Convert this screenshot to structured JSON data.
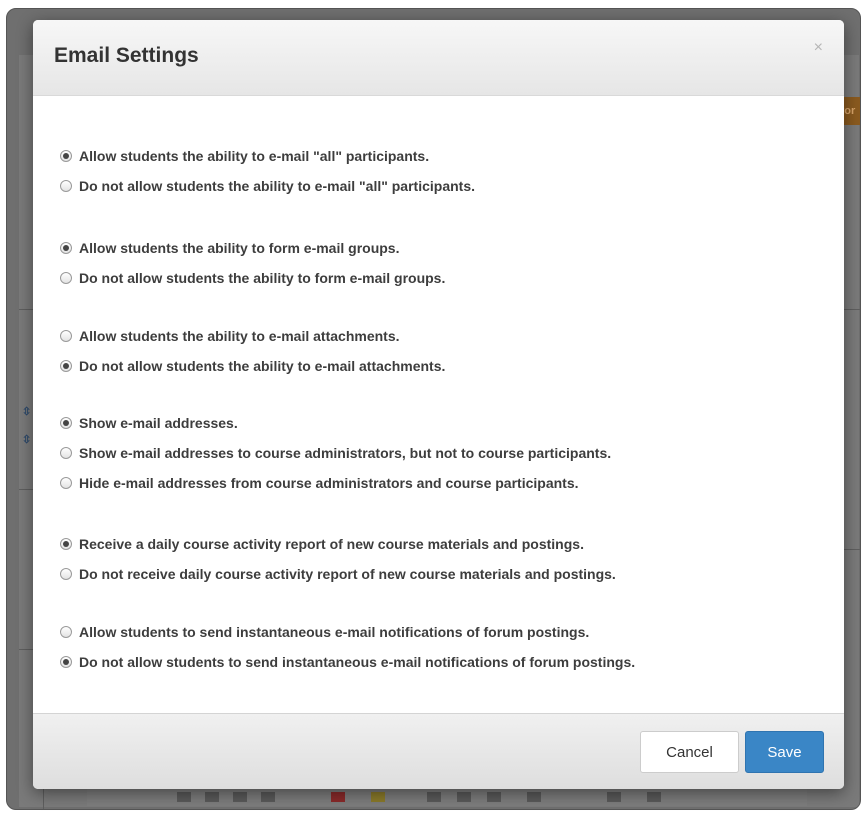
{
  "dialog": {
    "title": "Email Settings",
    "close_label": "×"
  },
  "groups": [
    {
      "options": [
        {
          "label": "Allow students the ability to e-mail \"all\" participants.",
          "checked": true
        },
        {
          "label": "Do not allow students the ability to e-mail \"all\" participants.",
          "checked": false
        }
      ]
    },
    {
      "options": [
        {
          "label": "Allow students the ability to form e-mail groups.",
          "checked": true
        },
        {
          "label": "Do not allow students the ability to form e-mail groups.",
          "checked": false
        }
      ]
    },
    {
      "options": [
        {
          "label": "Allow students the ability to e-mail attachments.",
          "checked": false
        },
        {
          "label": "Do not allow students the ability to e-mail attachments.",
          "checked": true
        }
      ]
    },
    {
      "options": [
        {
          "label": "Show e-mail addresses.",
          "checked": true
        },
        {
          "label": "Show e-mail addresses to course administrators, but not to course participants.",
          "checked": false
        },
        {
          "label": "Hide e-mail addresses from course administrators and course participants.",
          "checked": false
        }
      ]
    },
    {
      "options": [
        {
          "label": "Receive a daily course activity report of new course materials and postings.",
          "checked": true
        },
        {
          "label": "Do not receive daily course activity report of new course materials and postings.",
          "checked": false
        }
      ]
    },
    {
      "options": [
        {
          "label": "Allow students to send instantaneous e-mail notifications of forum postings.",
          "checked": false
        },
        {
          "label": "Do not allow students to send instantaneous e-mail notifications of forum postings.",
          "checked": true
        }
      ]
    }
  ],
  "footer": {
    "cancel_label": "Cancel",
    "save_label": "Save"
  },
  "background": {
    "corner_button_text": "ror"
  },
  "colors": {
    "primary": "#3a86c6",
    "title_text": "#333333",
    "label_text": "#3d3d3d"
  }
}
